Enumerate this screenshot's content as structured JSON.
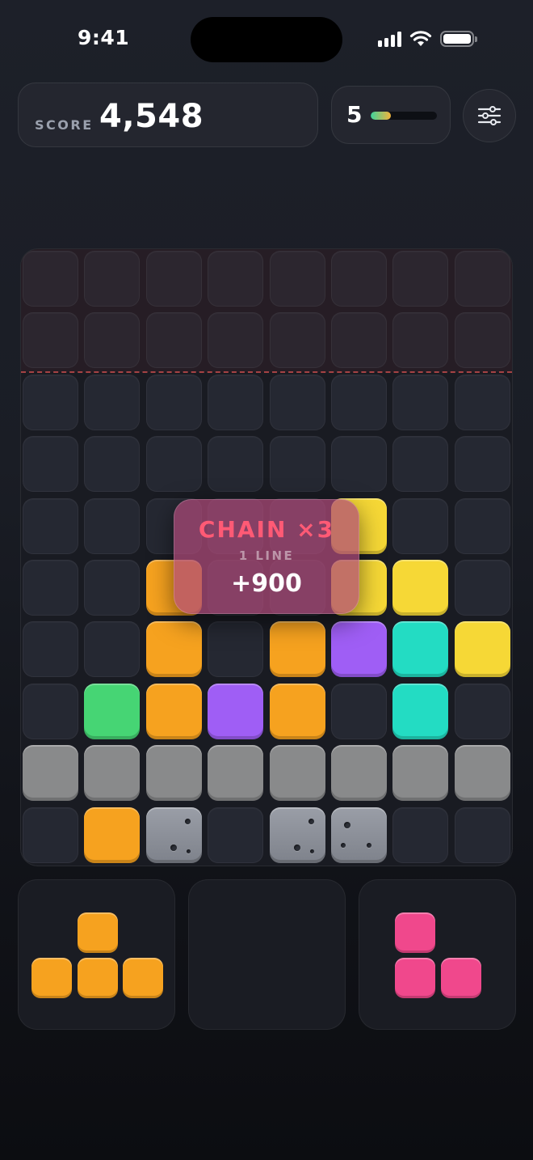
{
  "status_bar": {
    "time": "9:41",
    "icons": [
      "cellular-signal-icon",
      "wifi-icon",
      "battery-icon"
    ]
  },
  "header": {
    "score_label": "SCORE",
    "score_value": "4,548",
    "level": "5",
    "level_progress": 0.3,
    "settings_icon": "sliders-icon"
  },
  "colors": {
    "orange": "#f6a21f",
    "yellow": "#f6d836",
    "purple": "#9f5ef5",
    "teal": "#23dcc3",
    "green": "#46d574",
    "pink": "#f0488c",
    "gray": "#878a92",
    "stone": "#8b8f98"
  },
  "board": {
    "cols": 8,
    "rows": 10,
    "danger_rows": 2,
    "legend": "rows listed top to bottom; . = empty, O = orange, Y = yellow, P = purple, T = teal, G = green, S = stone, X = full-line (clearing)",
    "grid": [
      "........",
      "........",
      "........",
      "........",
      ".....Y..",
      "..O..YY.",
      "..O.OPTY",
      ".GOPO.T.",
      "XXXXXXXX",
      ".OS.SS.."
    ]
  },
  "popup": {
    "title": "CHAIN ×3",
    "subtitle": "1 LINE",
    "points": "+900"
  },
  "tray": [
    {
      "color": "orange",
      "shape": [
        ".X.",
        "XXX"
      ]
    },
    {
      "color": null,
      "shape": []
    },
    {
      "color": "pink",
      "shape": [
        "X.",
        "XX"
      ]
    }
  ]
}
